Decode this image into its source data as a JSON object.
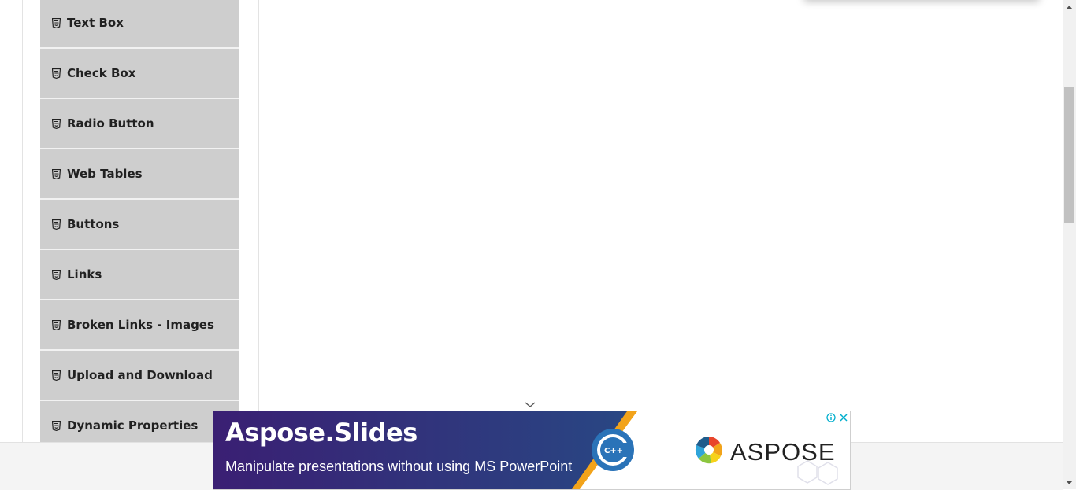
{
  "sidebar": {
    "items": [
      {
        "label": "Text Box",
        "icon": "html5-icon"
      },
      {
        "label": "Check Box",
        "icon": "html5-icon"
      },
      {
        "label": "Radio Button",
        "icon": "html5-icon"
      },
      {
        "label": "Web Tables",
        "icon": "html5-icon"
      },
      {
        "label": "Buttons",
        "icon": "html5-icon"
      },
      {
        "label": "Links",
        "icon": "html5-icon"
      },
      {
        "label": "Broken Links - Images",
        "icon": "html5-icon"
      },
      {
        "label": "Upload and Download",
        "icon": "html5-icon"
      },
      {
        "label": "Dynamic Properties",
        "icon": "html5-icon"
      }
    ]
  },
  "ad": {
    "title": "Aspose.Slides",
    "subtitle": "Manipulate presentations without using MS PowerPoint",
    "badge": "C++",
    "brand": "ASPOSE",
    "info_icon": "info-icon",
    "close_icon": "close-icon",
    "colors": {
      "gradient_start": "#3a1f73",
      "gradient_end": "#1f5c8c",
      "accent": "#f2a31a"
    }
  },
  "colors": {
    "menu_item_bg": "#cecece",
    "menu_item_text": "#212121",
    "footer_bg": "#f4f4f4",
    "scrollbar_thumb": "#c1c1c1"
  }
}
